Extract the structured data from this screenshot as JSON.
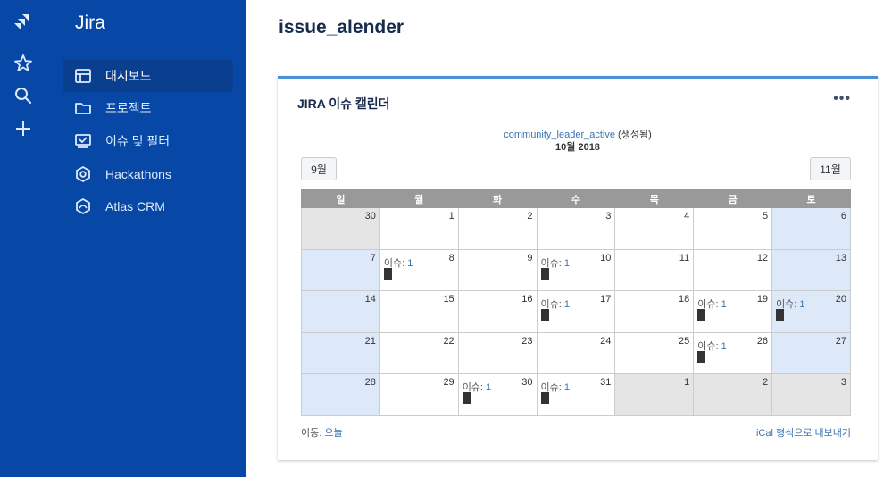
{
  "rail": {
    "icons": [
      "jira-logo-icon",
      "star-icon",
      "search-icon",
      "plus-icon"
    ]
  },
  "sidebar": {
    "brand": "Jira",
    "items": [
      {
        "label": "대시보드",
        "icon": "dashboard-icon",
        "active": true
      },
      {
        "label": "프로젝트",
        "icon": "folder-icon",
        "active": false
      },
      {
        "label": "이슈 및 필터",
        "icon": "issues-filter-icon",
        "active": false
      },
      {
        "label": "Hackathons",
        "icon": "hexagon-icon",
        "active": false
      },
      {
        "label": "Atlas CRM",
        "icon": "crm-icon",
        "active": false
      }
    ]
  },
  "page": {
    "title": "issue_alender"
  },
  "gadget": {
    "title": "JIRA 이슈 캘린더",
    "menu": "•••",
    "filter_link": "community_leader_active",
    "filter_note": " (생성됨)",
    "month_label": "10월 2018",
    "prev_label": "9월",
    "next_label": "11월",
    "weekdays": [
      "일",
      "월",
      "화",
      "수",
      "목",
      "금",
      "토"
    ],
    "footer_prefix": "이동: ",
    "footer_today": "오늘",
    "ical_label": "iCal 형식으로 내보내기",
    "issue_text": "이슈: ",
    "weeks": [
      [
        {
          "day": "30",
          "type": "other"
        },
        {
          "day": "1"
        },
        {
          "day": "2"
        },
        {
          "day": "3"
        },
        {
          "day": "4"
        },
        {
          "day": "5"
        },
        {
          "day": "6",
          "type": "weekend"
        }
      ],
      [
        {
          "day": "7",
          "type": "weekend"
        },
        {
          "day": "8",
          "issues": "1"
        },
        {
          "day": "9"
        },
        {
          "day": "10",
          "issues": "1"
        },
        {
          "day": "11"
        },
        {
          "day": "12"
        },
        {
          "day": "13",
          "type": "weekend"
        }
      ],
      [
        {
          "day": "14",
          "type": "weekend"
        },
        {
          "day": "15"
        },
        {
          "day": "16"
        },
        {
          "day": "17",
          "issues": "1"
        },
        {
          "day": "18"
        },
        {
          "day": "19",
          "issues": "1"
        },
        {
          "day": "20",
          "type": "weekend",
          "issues": "1"
        }
      ],
      [
        {
          "day": "21",
          "type": "weekend"
        },
        {
          "day": "22"
        },
        {
          "day": "23"
        },
        {
          "day": "24"
        },
        {
          "day": "25"
        },
        {
          "day": "26",
          "issues": "1"
        },
        {
          "day": "27",
          "type": "weekend"
        }
      ],
      [
        {
          "day": "28",
          "type": "weekend"
        },
        {
          "day": "29"
        },
        {
          "day": "30",
          "issues": "1"
        },
        {
          "day": "31",
          "issues": "1"
        },
        {
          "day": "1",
          "type": "other"
        },
        {
          "day": "2",
          "type": "other"
        },
        {
          "day": "3",
          "type": "other"
        }
      ]
    ]
  },
  "colors": {
    "sidebar_bg": "#0747a6",
    "active_item_bg": "#0a3e8f",
    "link": "#3b73af",
    "weekend_cell": "#dde9f8",
    "other_month_cell": "#e5e5e5",
    "header_row": "#999999"
  }
}
